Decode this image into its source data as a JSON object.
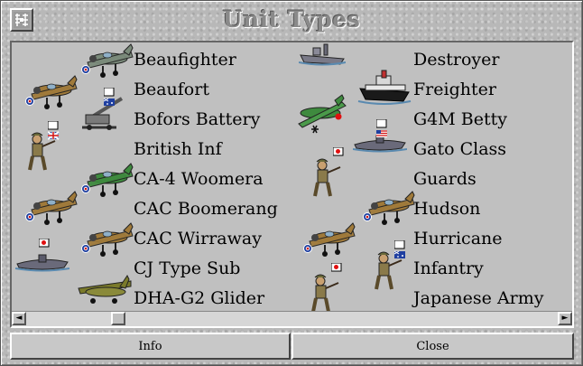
{
  "window": {
    "title": "Unit Types",
    "system_icon": "grid-icon"
  },
  "units": {
    "left": [
      {
        "name": "Beaufighter",
        "icon": "warplane-icon"
      },
      {
        "name": "Beaufort",
        "icon": "warplane-icon"
      },
      {
        "name": "Bofors Battery",
        "icon": "anti-aircraft-gun-icon"
      },
      {
        "name": "British Inf",
        "icon": "soldier-icon"
      },
      {
        "name": "CA-4 Woomera",
        "icon": "warplane-icon"
      },
      {
        "name": "CAC Boomerang",
        "icon": "warplane-icon"
      },
      {
        "name": "CAC Wirraway",
        "icon": "warplane-icon"
      },
      {
        "name": "CJ Type Sub",
        "icon": "submarine-icon"
      },
      {
        "name": "DHA-G2 Glider",
        "icon": "glider-icon"
      }
    ],
    "right": [
      {
        "name": "Destroyer",
        "icon": "destroyer-icon"
      },
      {
        "name": "Freighter",
        "icon": "freighter-icon"
      },
      {
        "name": "G4M Betty",
        "icon": "bomber-icon"
      },
      {
        "name": "Gato Class",
        "icon": "submarine-icon"
      },
      {
        "name": "Guards",
        "icon": "soldier-icon"
      },
      {
        "name": "Hudson",
        "icon": "warplane-icon"
      },
      {
        "name": "Hurricane",
        "icon": "warplane-icon"
      },
      {
        "name": "Infantry",
        "icon": "soldier-icon"
      },
      {
        "name": "Japanese Army",
        "icon": "soldier-icon"
      }
    ]
  },
  "scrollbar": {
    "left_arrow": "◄",
    "right_arrow": "►"
  },
  "buttons": {
    "info": "Info",
    "close": "Close"
  },
  "colors": {
    "window_bg": "#b8b8b8",
    "list_bg": "#c0c0c0",
    "raf_roundel_blue": "#1f3fa0",
    "raf_roundel_red": "#d01010",
    "japan_red": "#e01010",
    "olive": "#7a7a2a",
    "plane_green": "#3e8a3e"
  }
}
